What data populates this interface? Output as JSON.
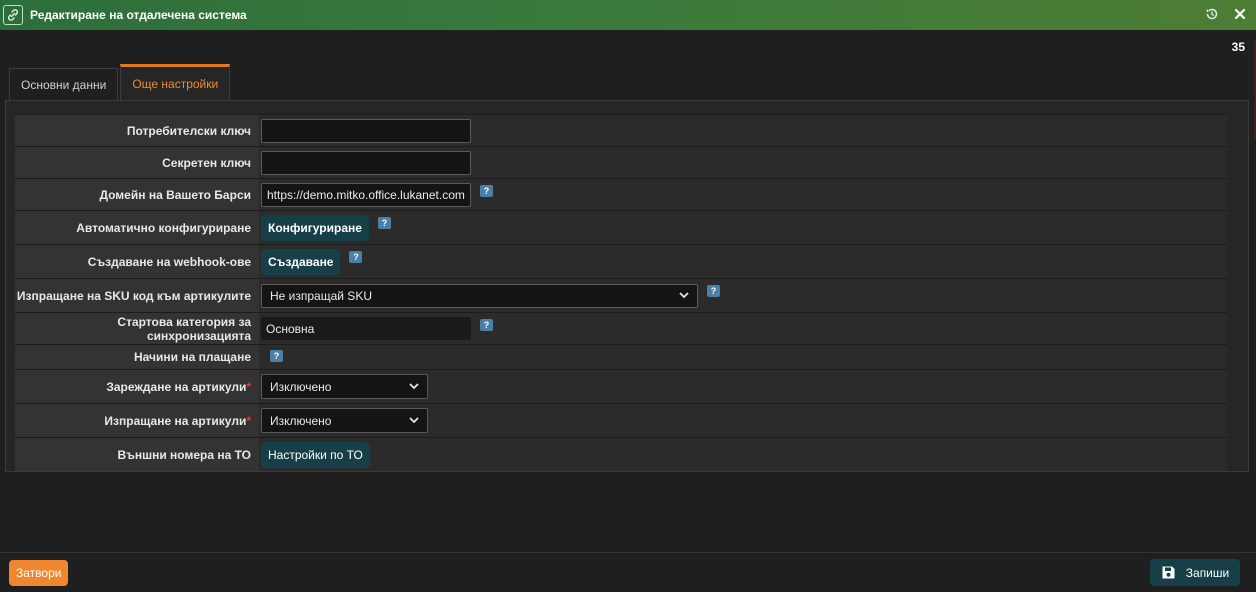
{
  "window": {
    "title": "Редактиране на отдалечена система",
    "counter": "35",
    "icons": {
      "title": "link-icon",
      "restore": "history-icon",
      "close": "close-icon"
    },
    "accent_color": "#e07b24"
  },
  "tabs": [
    {
      "label": "Основни данни",
      "active": false
    },
    {
      "label": "Още настройки",
      "active": true
    }
  ],
  "form": {
    "user_key": {
      "label": "Потребителски ключ",
      "value": ""
    },
    "secret_key": {
      "label": "Секретен ключ",
      "value": ""
    },
    "domain": {
      "label": "Домейн на Вашето Барси",
      "value": "https://demo.mitko.office.lukanet.com"
    },
    "auto_config": {
      "label": "Автоматично конфигуриране",
      "button": "Конфигуриране"
    },
    "webhooks": {
      "label": "Създаване на webhook-ове",
      "button": "Създаване"
    },
    "send_sku": {
      "label": "Изпращане на SKU код към артикулите",
      "selected": "Не изпращай SKU"
    },
    "start_category": {
      "label": "Стартова категория за синхронизацията",
      "value": "Основна"
    },
    "payment_methods": {
      "label": "Начини на плащане"
    },
    "load_items": {
      "label": "Зареждане на артикули",
      "required": "*",
      "selected": "Изключено"
    },
    "send_items": {
      "label": "Изпращане на артикули",
      "required": "*",
      "selected": "Изключено"
    },
    "external_numbers": {
      "label": "Външни номера на ТО",
      "button": "Настройки по ТО"
    },
    "help_glyph": "?"
  },
  "footer": {
    "close_label": "Затвори",
    "save_label": "Запиши",
    "save_icon": "floppy-disk-icon"
  }
}
